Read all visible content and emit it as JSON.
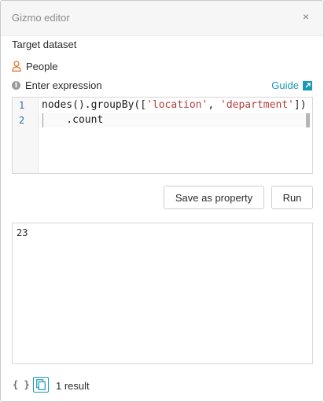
{
  "panel": {
    "title": "Gizmo editor",
    "close_glyph": "×"
  },
  "dataset": {
    "label": "Target dataset",
    "name": "People",
    "icon": "person-icon"
  },
  "expression": {
    "label": "Enter expression",
    "guide_label": "Guide",
    "line_numbers": [
      "1",
      "2"
    ],
    "code_line1_pre": "nodes().groupBy([",
    "code_line1_str1": "'location'",
    "code_line1_sep": ", ",
    "code_line1_str2": "'department'",
    "code_line1_post": "])",
    "code_line2": "    .count"
  },
  "actions": {
    "save_label": "Save as property",
    "run_label": "Run"
  },
  "result": {
    "value": "23",
    "count_label": "1 result",
    "json_glyph": "{ }"
  },
  "colors": {
    "accent": "#1a9ab8",
    "string": "#b0413e",
    "person_icon": "#e07b2e"
  }
}
